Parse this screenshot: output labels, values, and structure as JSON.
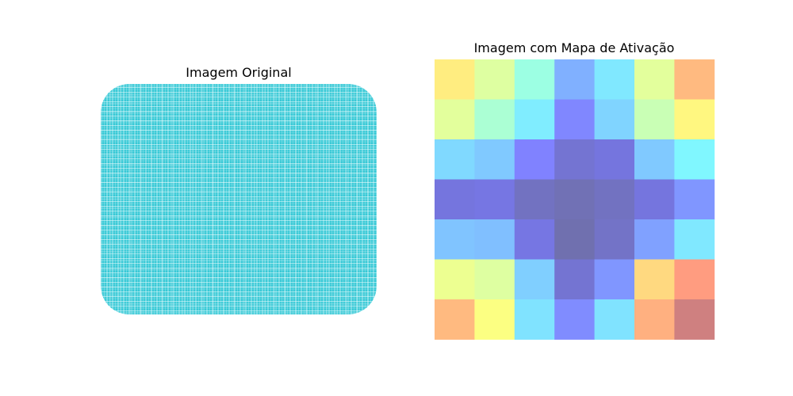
{
  "chart_data": [
    {
      "type": "image",
      "title": "Imagem Original",
      "image": {
        "description_free": true,
        "fill_color": "#38c9d6",
        "thread_color": "#ffffff"
      }
    },
    {
      "type": "heatmap",
      "title": "Imagem com Mapa de Ativação",
      "rows": 7,
      "cols": 7,
      "colormap": "jet",
      "alpha": 0.5,
      "values": [
        [
          0.66,
          0.56,
          0.43,
          0.22,
          0.33,
          0.57,
          0.76
        ],
        [
          0.57,
          0.46,
          0.34,
          0.14,
          0.29,
          0.52,
          0.64
        ],
        [
          0.3,
          0.27,
          0.13,
          0.07,
          0.09,
          0.27,
          0.36
        ],
        [
          0.09,
          0.1,
          0.04,
          0.02,
          0.04,
          0.09,
          0.17
        ],
        [
          0.26,
          0.25,
          0.1,
          0.01,
          0.05,
          0.19,
          0.33
        ],
        [
          0.59,
          0.56,
          0.28,
          0.07,
          0.17,
          0.7,
          0.82
        ],
        [
          0.76,
          0.62,
          0.32,
          0.15,
          0.32,
          0.78,
          0.97
        ]
      ]
    }
  ]
}
